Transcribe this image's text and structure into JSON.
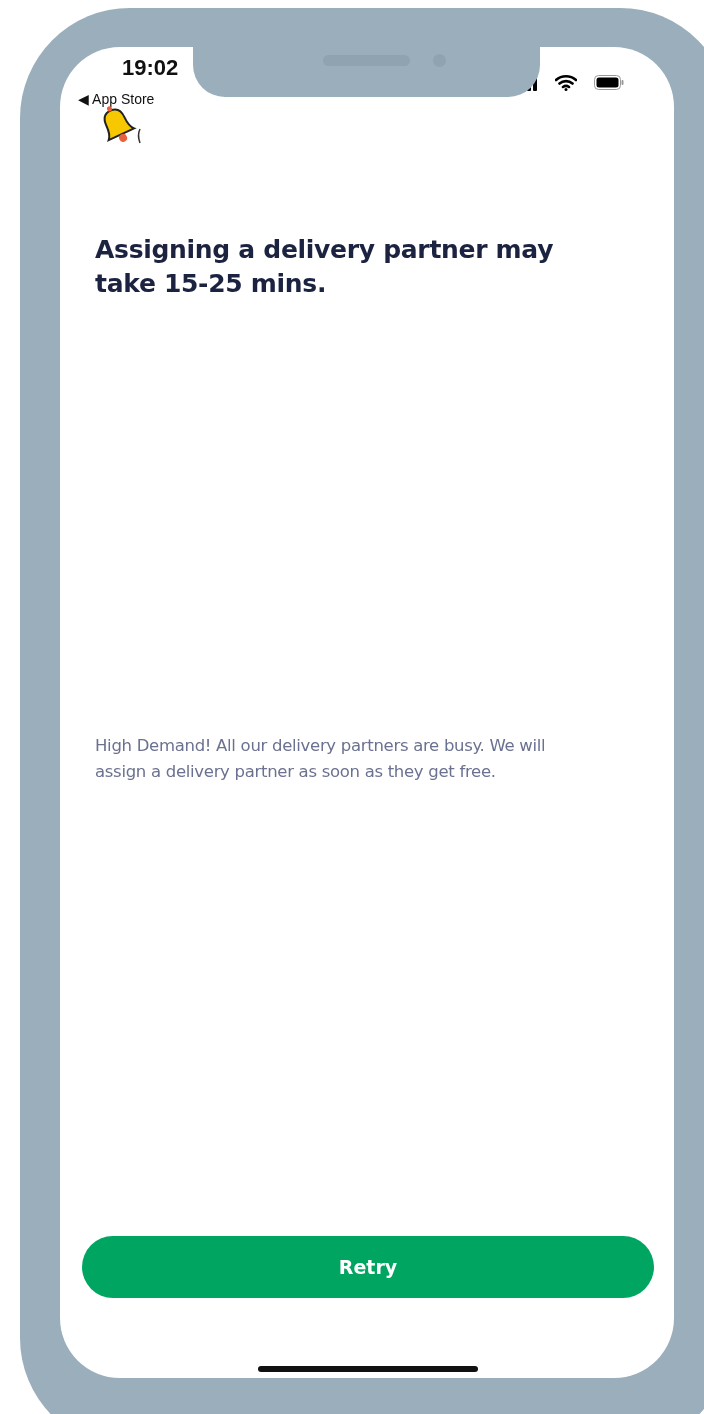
{
  "status_bar": {
    "time": "19:02",
    "back_link": "◀ App Store"
  },
  "headline": "Assigning a delivery partner may take 15-25 mins.",
  "message": "High Demand! All our delivery partners are busy. We will assign a delivery partner as soon as they get free.",
  "primary_button": {
    "label": "Retry"
  }
}
